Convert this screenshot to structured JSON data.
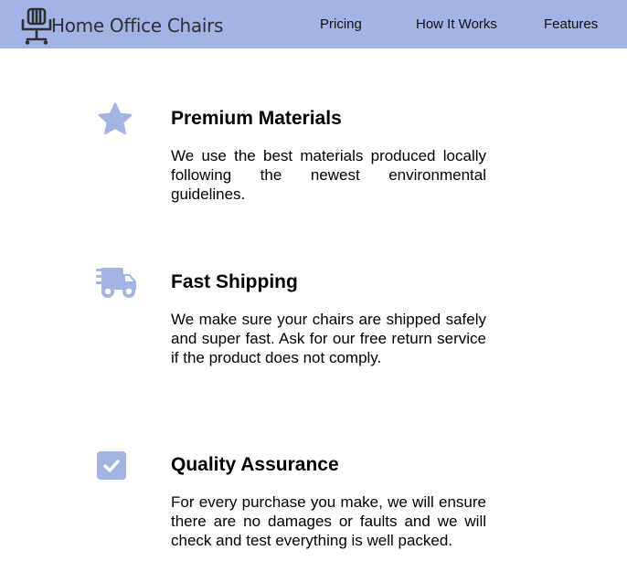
{
  "header": {
    "brand": "Home Office Chairs",
    "logo_icon": "office-chair-icon",
    "background": "#a3b3e3",
    "nav": [
      {
        "label": "Pricing"
      },
      {
        "label": "How It Works"
      },
      {
        "label": "Features"
      }
    ]
  },
  "features": [
    {
      "icon": "star-icon",
      "title": "Premium Materials",
      "description": "We use the best materials produced locally following the newest environmental guidelines."
    },
    {
      "icon": "shipping-truck-icon",
      "title": "Fast Shipping",
      "description": "We make sure your chairs are shipped safely and super fast. Ask for our free return service if the product does not comply."
    },
    {
      "icon": "checkbox-icon",
      "title": "Quality Assurance",
      "description": "For every purchase you make, we will ensure there are no damages or faults and we will check and test everything is well packed."
    }
  ],
  "colors": {
    "accent": "#a3b3e3",
    "text": "#000000"
  }
}
